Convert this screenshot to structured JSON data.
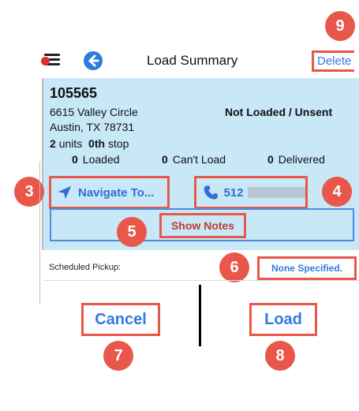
{
  "header": {
    "title": "Load Summary",
    "delete_label": "Delete"
  },
  "stop": {
    "id": "105565",
    "address_line1": "6615 Valley Circle",
    "address_line2": "Austin, TX 78731",
    "units_count": "2",
    "units_label": "units",
    "stop_number": "0th",
    "stop_label": "stop",
    "status": "Not Loaded / Unsent",
    "stats": [
      {
        "count": "0",
        "label": "Loaded"
      },
      {
        "count": "0",
        "label": "Can't Load"
      },
      {
        "count": "0",
        "label": "Delivered"
      }
    ]
  },
  "actions": {
    "navigate_label": "Navigate To...",
    "phone_label": "512",
    "show_notes_label": "Show Notes",
    "scheduled_pickup_label": "Scheduled Pickup:",
    "scheduled_pickup_value": "None Specified.",
    "cancel_label": "Cancel",
    "load_label": "Load"
  },
  "callouts": [
    "3",
    "4",
    "5",
    "6",
    "7",
    "8",
    "9"
  ],
  "colors": {
    "panel_bg": "#c8e7f7",
    "accent_blue": "#2f7be0",
    "callout_red": "#e8574a"
  },
  "icons": {
    "menu": "menu-icon",
    "back": "back-arrow-icon",
    "navigate": "location-arrow-icon",
    "phone": "phone-icon"
  }
}
